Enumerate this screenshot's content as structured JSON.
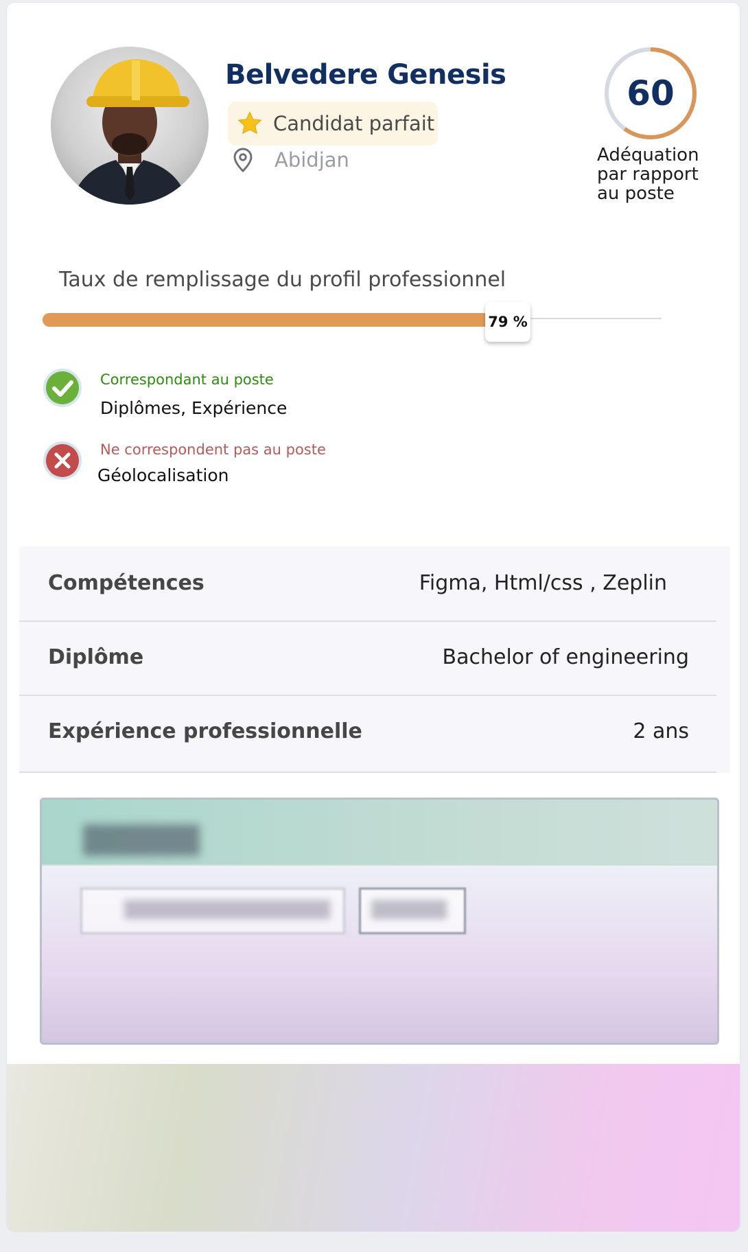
{
  "candidate": {
    "name": "Belvedere Genesis",
    "badge": {
      "icon": "star-icon",
      "label": "Candidat parfait"
    },
    "location": {
      "icon": "location-pin-icon",
      "label": "Abidjan"
    }
  },
  "match_score": {
    "value": "60",
    "fraction": 0.6,
    "label": "Adéquation par rapport au poste",
    "colors": {
      "arc": "#d9965a",
      "track": "#d5d9e2"
    }
  },
  "profile_completion": {
    "title": "Taux de remplissage du profil professionnel",
    "percent": 79,
    "percent_label": "79 %",
    "fill_color": "#e19a55"
  },
  "criteria": {
    "matching": {
      "heading": "Correspondant au poste",
      "items": "Diplômes, Expérience",
      "icon": "check-circle-icon",
      "color": "#2e8b0f"
    },
    "not_matching": {
      "heading": "Ne correspondent pas au poste",
      "items": "Géolocalisation",
      "icon": "x-circle-icon",
      "color": "#b35b5b"
    }
  },
  "details": [
    {
      "label": "Compétences",
      "value": "Figma, Html/css , Zeplin"
    },
    {
      "label": "Diplôme",
      "value": "Bachelor of engineering"
    },
    {
      "label": "Expérience professionnelle",
      "value": "2 ans"
    }
  ]
}
